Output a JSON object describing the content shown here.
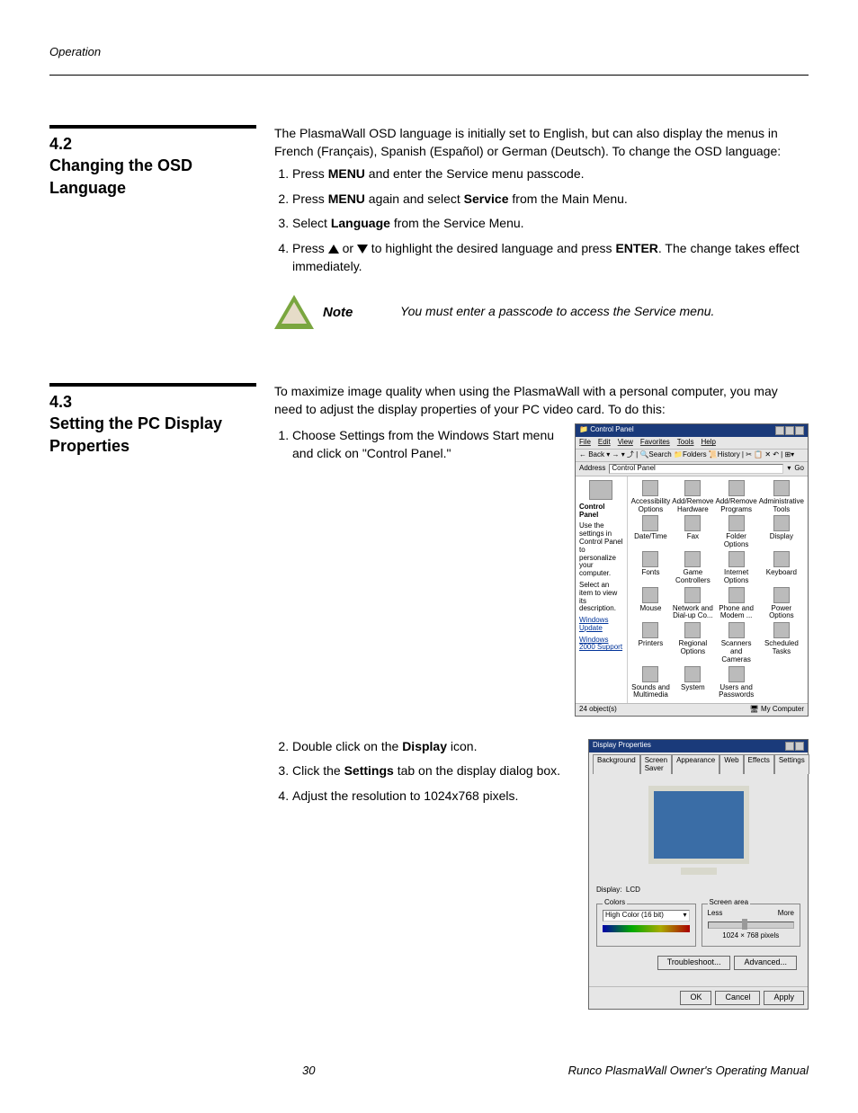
{
  "header": {
    "section_label": "Operation"
  },
  "s42": {
    "num": "4.2",
    "title": "Changing the OSD Language",
    "intro": "The PlasmaWall OSD language is initially set to English, but can also display the menus in French (Français), Spanish (Español) or German (Deutsch). To change the OSD language:",
    "steps": {
      "s1a": "Press ",
      "s1b": "MENU",
      "s1c": " and enter the Service menu passcode.",
      "s2a": "Press ",
      "s2b": "MENU",
      "s2c": " again and select ",
      "s2d": "Service",
      "s2e": " from the Main Menu.",
      "s3a": "Select ",
      "s3b": "Language",
      "s3c": " from the Service Menu.",
      "s4a": "Press ",
      "s4b": " or ",
      "s4c": " to highlight the desired language and press ",
      "s4d": "ENTER",
      "s4e": ". The change takes effect immediately."
    },
    "note_label": "Note",
    "note_text": "You must enter a passcode to access the Service menu."
  },
  "s43": {
    "num": "4.3",
    "title": "Setting the PC Display Properties",
    "intro": "To maximize image quality when using the PlasmaWall with a personal computer, you may need to adjust the display properties of your PC video card. To do this:",
    "steps": {
      "s1": "Choose Settings from the Windows Start menu and click on \"Control Panel.\"",
      "s2a": "Double click on the ",
      "s2b": "Display",
      "s2c": " icon.",
      "s3a": "Click the ",
      "s3b": "Settings",
      "s3c": " tab on the display dialog box.",
      "s4": "Adjust the resolution to 1024x768 pixels."
    }
  },
  "control_panel": {
    "title": "Control Panel",
    "menus": [
      "File",
      "Edit",
      "View",
      "Favorites",
      "Tools",
      "Help"
    ],
    "toolbar": "← Back ▾  → ▾  ⤴  | 🔍Search  📁Folders  📜History | ✂ 📋 ✕ ↶ | ⊞▾",
    "address_label": "Address",
    "address_value": "Control Panel",
    "go": "Go",
    "side_title": "Control Panel",
    "side_desc": "Use the settings in Control Panel to personalize your computer.",
    "side_desc2": "Select an item to view its description.",
    "side_links": [
      "Windows Update",
      "Windows 2000 Support"
    ],
    "items": [
      "Accessibility Options",
      "Add/Remove Hardware",
      "Add/Remove Programs",
      "Administrative Tools",
      "Date/Time",
      "Fax",
      "Folder Options",
      "Display",
      "Fonts",
      "Game Controllers",
      "Internet Options",
      "Keyboard",
      "Mouse",
      "Network and Dial-up Co...",
      "Phone and Modem ...",
      "Power Options",
      "Printers",
      "Regional Options",
      "Scanners and Cameras",
      "Scheduled Tasks",
      "Sounds and Multimedia",
      "System",
      "Users and Passwords"
    ],
    "status_left": "24 object(s)",
    "status_right": "My Computer"
  },
  "display_props": {
    "title": "Display Properties",
    "tabs": [
      "Background",
      "Screen Saver",
      "Appearance",
      "Web",
      "Effects",
      "Settings"
    ],
    "display_label": "Display:",
    "display_value": "LCD",
    "colors_label": "Colors",
    "colors_value": "High Color (16 bit)",
    "screen_label": "Screen area",
    "less": "Less",
    "more": "More",
    "resolution": "1024 × 768 pixels",
    "troubleshoot": "Troubleshoot...",
    "advanced": "Advanced...",
    "ok": "OK",
    "cancel": "Cancel",
    "apply": "Apply"
  },
  "footer": {
    "page": "30",
    "manual": "Runco PlasmaWall Owner's Operating Manual"
  }
}
